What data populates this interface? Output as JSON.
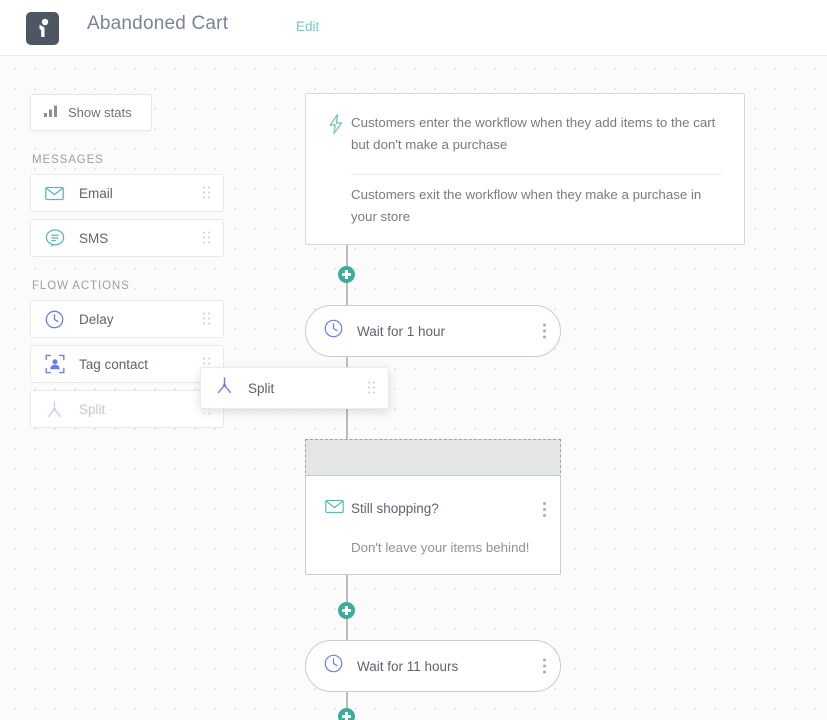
{
  "header": {
    "logo_icon": "person-badge-logo",
    "title": "Abandoned Cart",
    "edit_label": "Edit",
    "edit_color": "#74c7c5"
  },
  "sidebar": {
    "stats_button": {
      "label": "Show stats",
      "icon": "bar-chart-icon"
    },
    "sections": [
      {
        "label": "MESSAGES",
        "items": [
          {
            "label": "Email",
            "icon": "envelope-icon",
            "color": "#5fb8b4",
            "disabled": false
          },
          {
            "label": "SMS",
            "icon": "chat-bubble-icon",
            "color": "#5fb8b4",
            "disabled": false
          }
        ]
      },
      {
        "label": "FLOW ACTIONS",
        "items": [
          {
            "label": "Delay",
            "icon": "clock-icon",
            "color": "#6c7cf0",
            "disabled": false
          },
          {
            "label": "Tag contact",
            "icon": "tag-contact-icon",
            "color": "#6c7cf0",
            "disabled": false
          },
          {
            "label": "Split",
            "icon": "split-icon",
            "color": "#c9cdf7",
            "disabled": true
          }
        ]
      }
    ]
  },
  "drag_card": {
    "label": "Split",
    "icon": "split-icon",
    "color": "#6c7cf0"
  },
  "flow": {
    "trigger": {
      "icon": "lightning-bolt-icon",
      "entry_text": "Customers enter the workflow when they add items to the cart but don't make a purchase",
      "exit_text": "Customers exit the workflow when they make a purchase in your store"
    },
    "nodes": [
      {
        "type": "delay",
        "icon": "clock-icon",
        "label": "Wait for 1 hour"
      },
      {
        "type": "email",
        "icon": "envelope-icon",
        "title": "Still shopping?",
        "subtitle": "Don't leave your items behind!"
      },
      {
        "type": "delay",
        "icon": "clock-icon",
        "label": "Wait for 11 hours"
      }
    ],
    "add_button_icon": "plus-icon",
    "accent_color": "#3dab9e"
  }
}
